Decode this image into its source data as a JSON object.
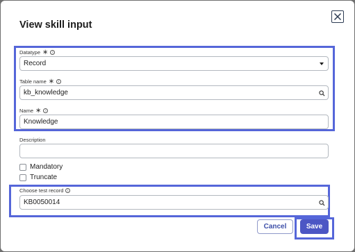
{
  "dialog": {
    "title": "View skill input",
    "close_icon": "close-x-icon"
  },
  "form": {
    "datatype": {
      "label": "Datatype",
      "value": "Record",
      "required_mark": "∗",
      "info_icon": "info-icon"
    },
    "table_name": {
      "label": "Table name",
      "value": "kb_knowledge",
      "required_mark": "∗",
      "info_icon": "info-icon",
      "action_icon": "search-icon"
    },
    "name": {
      "label": "Name",
      "value": "Knowledge",
      "required_mark": "∗",
      "info_icon": "info-icon"
    },
    "description": {
      "label": "Description",
      "value": ""
    },
    "mandatory": {
      "label": "Mandatory",
      "checked": false
    },
    "truncate": {
      "label": "Truncate",
      "checked": false
    },
    "test_record": {
      "label": "Choose test record",
      "value": "KB0050014",
      "info_icon": "info-icon",
      "action_icon": "search-icon"
    }
  },
  "buttons": {
    "cancel": "Cancel",
    "save": "Save"
  },
  "colors": {
    "highlight": "#5566d9",
    "primary": "#4c56c4",
    "overlay": "#6f6f6f"
  }
}
